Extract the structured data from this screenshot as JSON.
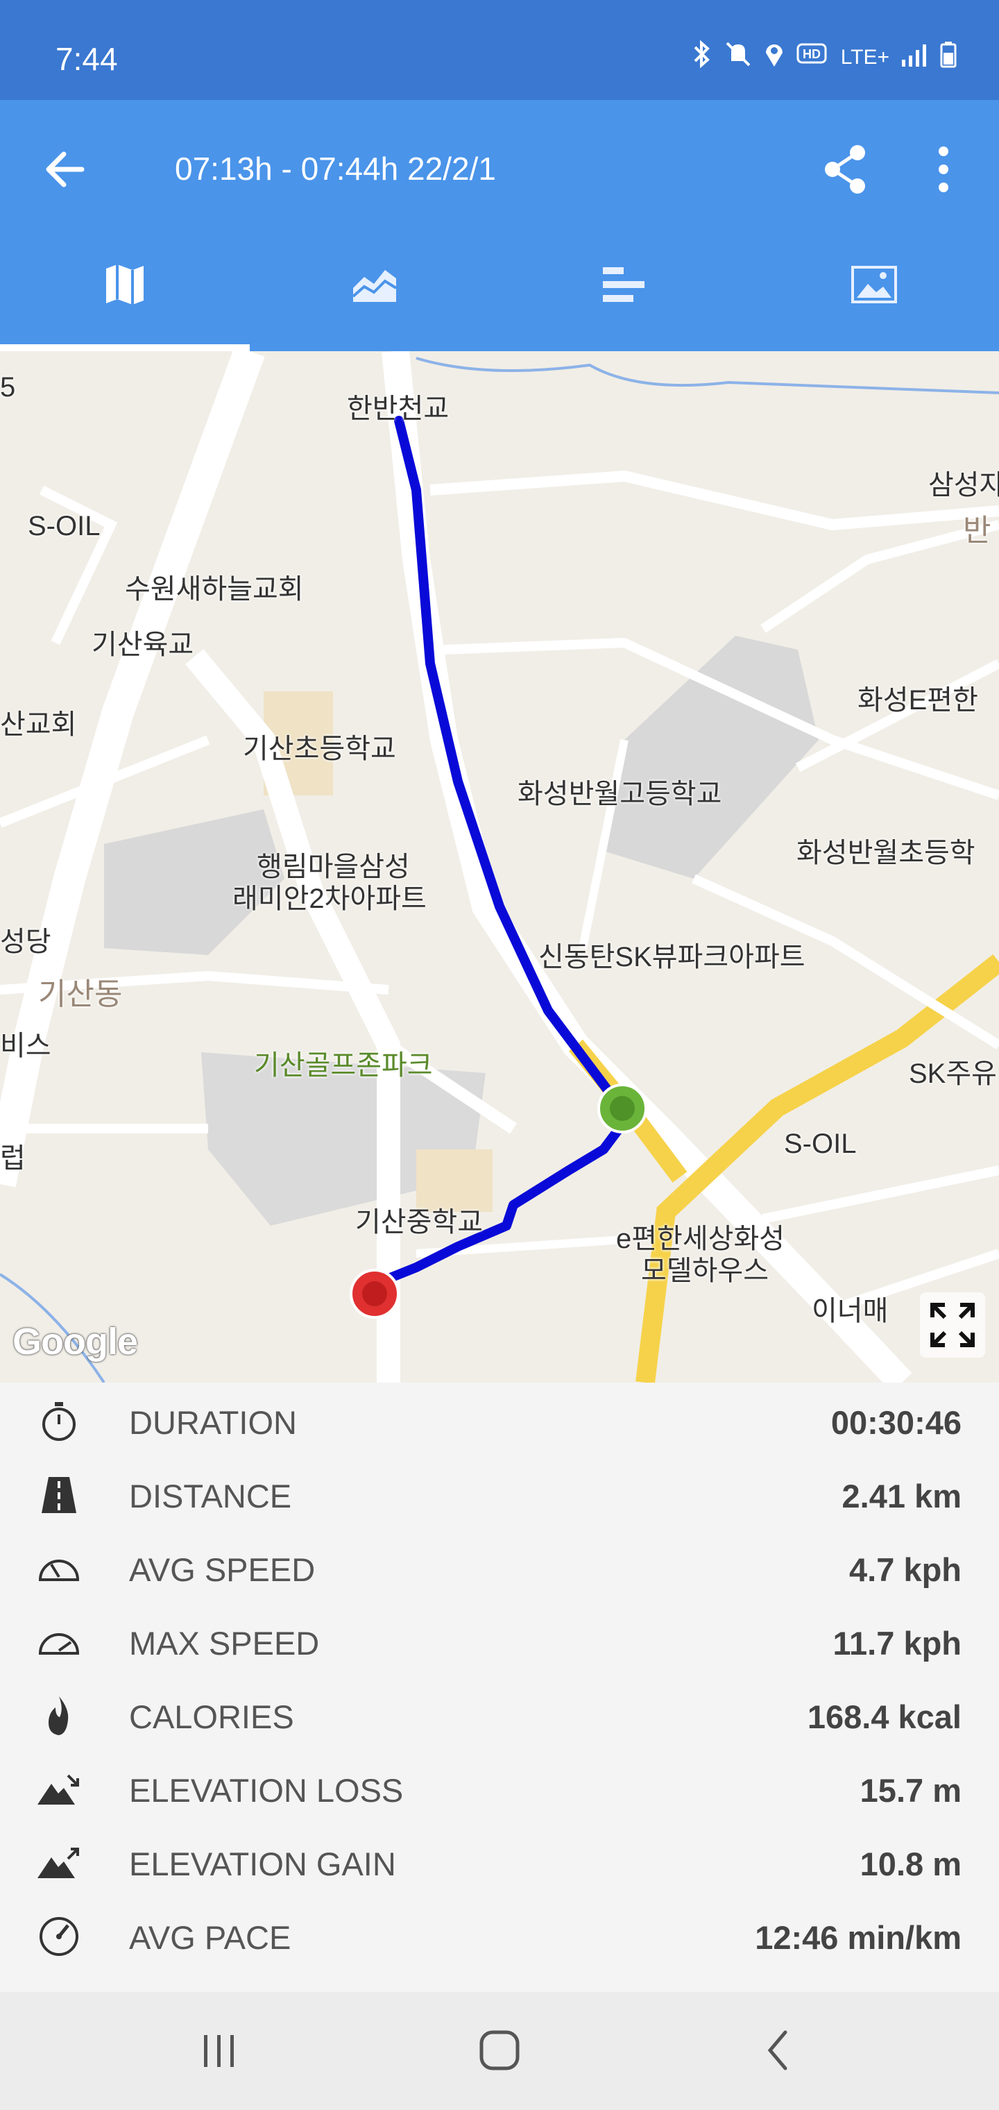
{
  "status_bar": {
    "time": "7:44",
    "network": "LTE+",
    "hd": "HD",
    "icons": [
      "bluetooth-icon",
      "mute-icon",
      "location-icon",
      "hd-voice-icon",
      "lte-icon",
      "signal-icon",
      "battery-icon"
    ]
  },
  "app_bar": {
    "title": "07:13h - 07:44h   22/2/1",
    "back_icon": "arrow-left-icon",
    "share_icon": "share-icon",
    "more_icon": "more-vert-icon",
    "color": "#4a94ea",
    "status_color": "#3a78d1"
  },
  "tabs": [
    {
      "icon": "map-icon",
      "active": true
    },
    {
      "icon": "chart-icon",
      "active": false
    },
    {
      "icon": "bars-icon",
      "active": false
    },
    {
      "icon": "image-icon",
      "active": false
    }
  ],
  "map": {
    "labels": {
      "hanban_bridge": "한반천교",
      "soil1": "S-OIL",
      "suwon_church": "수원새하늘교회",
      "gisan_bridge": "기산육교",
      "san_church": "산교회",
      "gisan_elem": "기산초등학교",
      "haengrim_apt1": "행림마을삼성",
      "haengrim_apt2": "래미안2차아파트",
      "seongdang": "성당",
      "gisan_dong": "기산동",
      "bis": "비스",
      "reop": "럽",
      "golf_park": "기산골프존파크",
      "gisan_middle": "기산중학교",
      "hwaseong_high": "화성반월고등학교",
      "sindongtan_apt": "신동탄SK뷰파크아파트",
      "samsung_right": "삼성자",
      "ban_right": "반",
      "hwaseong_e": "화성E편한",
      "hwaseong_elem_right": "화성반월초등학",
      "sk_right": "SK주유",
      "soil2": "S-OIL",
      "epyeonhan1": "e편한세상화성",
      "epyeonhan2": "모델하우스",
      "inne": "이너매",
      "corner_5": "5"
    },
    "google_logo": "Google",
    "route_color": "#0a0ad8",
    "start_color": "#6ab43a",
    "end_color": "#e03030",
    "fullscreen_icon": "fullscreen-icon"
  },
  "stats": [
    {
      "icon": "stopwatch-icon",
      "label": "DURATION",
      "value": "00:30:46"
    },
    {
      "icon": "road-icon",
      "label": "DISTANCE",
      "value": "2.41 km"
    },
    {
      "icon": "speedometer-icon",
      "label": "AVG SPEED",
      "value": "4.7 kph"
    },
    {
      "icon": "speedometer-max-icon",
      "label": "MAX SPEED",
      "value": "11.7 kph"
    },
    {
      "icon": "fire-icon",
      "label": "CALORIES",
      "value": "168.4 kcal"
    },
    {
      "icon": "mountain-down-icon",
      "label": "ELEVATION LOSS",
      "value": "15.7 m"
    },
    {
      "icon": "mountain-up-icon",
      "label": "ELEVATION GAIN",
      "value": "10.8 m"
    },
    {
      "icon": "gauge-icon",
      "label": "AVG PACE",
      "value": "12:46 min/km"
    }
  ],
  "nav_bar": {
    "recents_icon": "recents-icon",
    "home_icon": "home-icon",
    "back_icon": "nav-back-icon"
  }
}
